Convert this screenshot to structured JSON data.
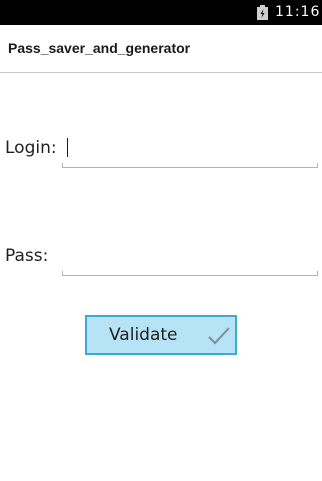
{
  "status_bar": {
    "time": "11:16",
    "icons": [
      "battery-icon"
    ]
  },
  "app_title": "Pass_saver_and_generator",
  "form": {
    "login_label": "Login:",
    "login_value": "",
    "pass_label": "Pass:",
    "pass_value": "",
    "validate_label": "Validate",
    "validate_icon": "checkmark-icon"
  },
  "colors": {
    "button_fill": "#b6e3f6",
    "button_border": "#3fa9d6",
    "status_bar": "#000000"
  }
}
